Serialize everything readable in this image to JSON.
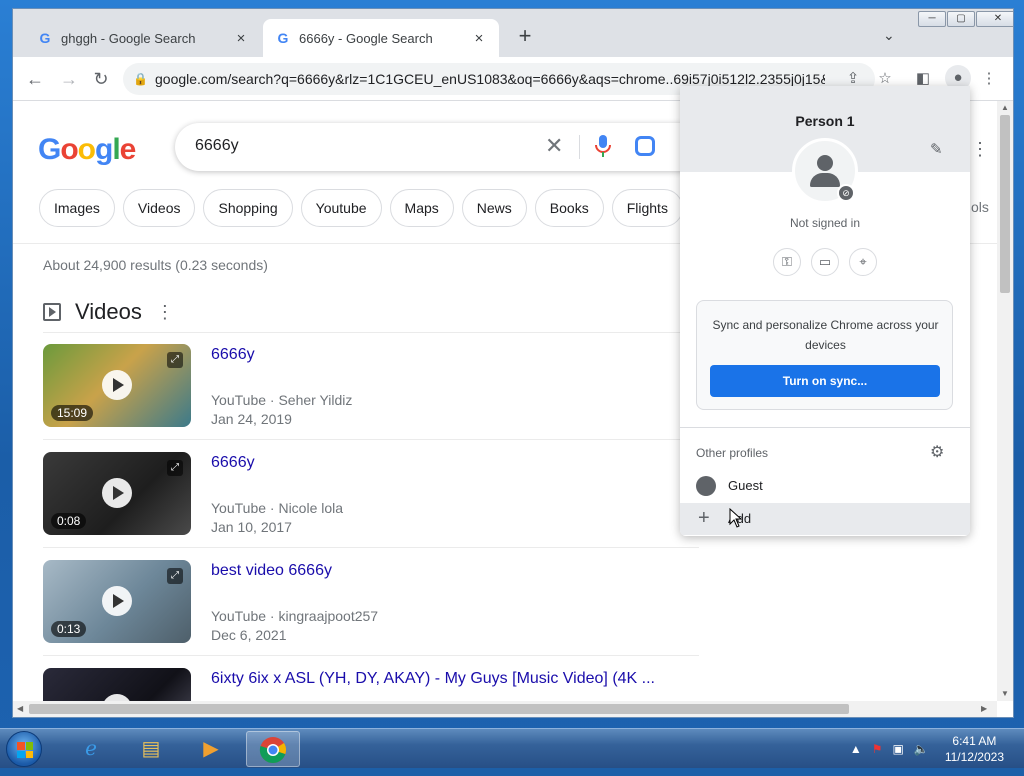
{
  "tabs": [
    {
      "label": "ghggh - Google Search",
      "close": "×"
    },
    {
      "label": "6666y - Google Search",
      "close": "×"
    }
  ],
  "toolbar": {
    "url": "google.com/search?q=6666y&rlz=1C1GCEU_enUS1083&oq=6666y&aqs=chrome..69i57j0i512l2.2355j0j15&..."
  },
  "search": {
    "logo": [
      "G",
      "o",
      "o",
      "g",
      "l",
      "e"
    ],
    "query": "6666y",
    "chips": [
      "Images",
      "Videos",
      "Shopping",
      "Youtube",
      "Maps",
      "News",
      "Books",
      "Flights"
    ],
    "tools_fragment": "ols",
    "stats": "About 24,900 results (0.23 seconds)"
  },
  "videos": {
    "heading": "Videos",
    "items": [
      {
        "title": "6666y",
        "source": "YouTube · Seher Yildiz",
        "date": "Jan 24, 2019",
        "duration": "15:09",
        "thumb_color": "#5a8a3a"
      },
      {
        "title": "6666y",
        "source": "YouTube · Nicole lola",
        "date": "Jan 10, 2017",
        "duration": "0:08",
        "thumb_color": "#2b2b2b"
      },
      {
        "title": "best video 6666y",
        "source": "YouTube · kingraajpoot257",
        "date": "Dec 6, 2021",
        "duration": "0:13",
        "thumb_color": "#8fa6b8"
      },
      {
        "title": "6ixty 6ix x ASL (YH, DY, AKAY) - My Guys [Music Video] (4K ...",
        "source": "",
        "date": "",
        "duration": "",
        "thumb_color": "#1c1c22"
      }
    ]
  },
  "profile_menu": {
    "name": "Person 1",
    "status": "Not signed in",
    "sync_text": "Sync and personalize Chrome across your devices",
    "sync_button": "Turn on sync...",
    "other_profiles": "Other profiles",
    "guest": "Guest",
    "add": "Add"
  },
  "taskbar": {
    "time": "6:41 AM",
    "date": "11/12/2023"
  },
  "colors": {
    "accent": "#1a73e8",
    "link": "#1a0dab"
  }
}
